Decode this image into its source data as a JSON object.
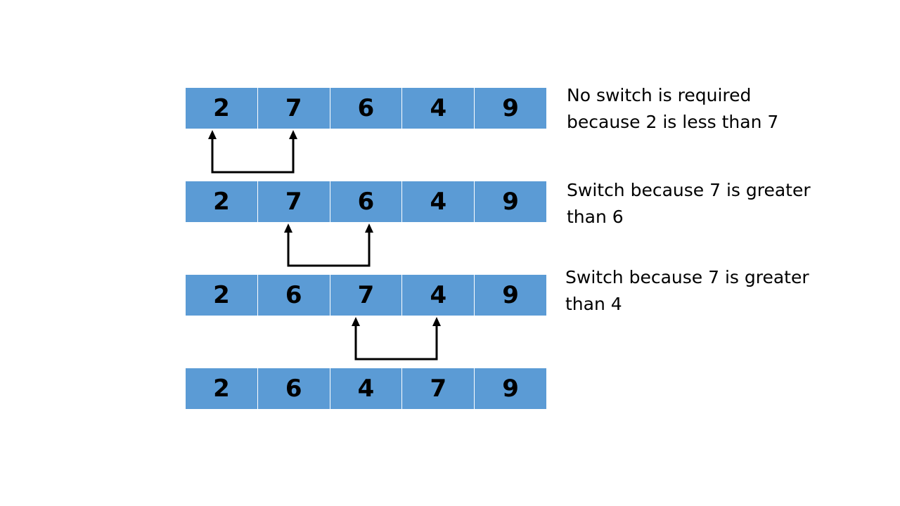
{
  "rows": [
    {
      "values": [
        "2",
        "7",
        "6",
        "4",
        "9"
      ],
      "note": [
        "No switch is required",
        "because 2 is less than 7"
      ]
    },
    {
      "values": [
        "2",
        "7",
        "6",
        "4",
        "9"
      ],
      "note": [
        "Switch because 7 is greater",
        "than 6"
      ]
    },
    {
      "values": [
        "2",
        "6",
        "7",
        "4",
        "9"
      ],
      "note": [
        "Switch because 7 is greater",
        "than 4"
      ]
    },
    {
      "values": [
        "2",
        "6",
        "4",
        "7",
        "9"
      ],
      "note": []
    }
  ],
  "comparisons": [
    {
      "between_rows": [
        0,
        1
      ],
      "indices": [
        0,
        1
      ]
    },
    {
      "between_rows": [
        1,
        2
      ],
      "indices": [
        1,
        2
      ]
    },
    {
      "between_rows": [
        2,
        3
      ],
      "indices": [
        2,
        3
      ]
    }
  ],
  "colors": {
    "cell": "#5b9bd5",
    "text": "#000000",
    "background": "#ffffff"
  }
}
